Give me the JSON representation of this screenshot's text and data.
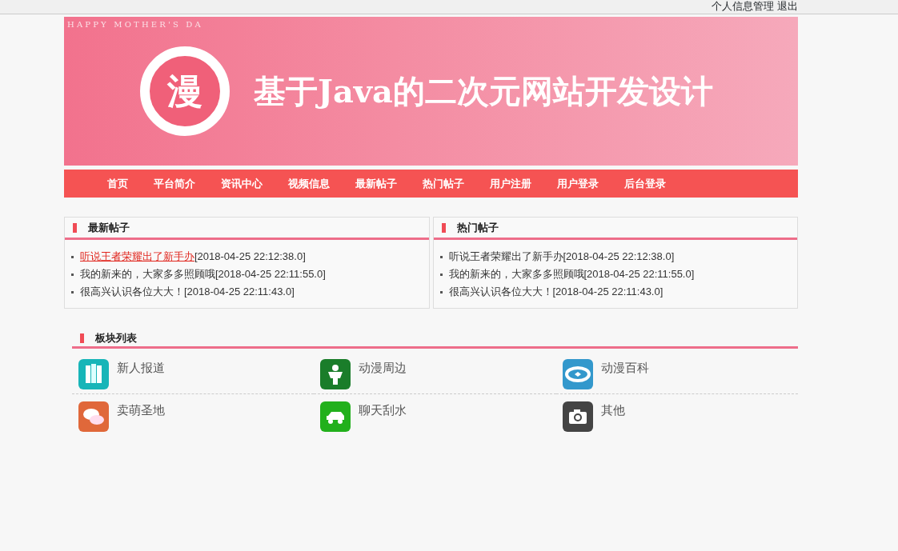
{
  "top_links": [
    "个人信息管理",
    "退出"
  ],
  "banner": {
    "tagline": "H A P P Y   M O T H E R ' S   D A",
    "logo_char": "漫",
    "title": "基于Java的二次元网站开发设计"
  },
  "nav": [
    "首页",
    "平台简介",
    "资讯中心",
    "视频信息",
    "最新帖子",
    "热门帖子",
    "用户注册",
    "用户登录",
    "后台登录"
  ],
  "panels": [
    {
      "title": "最新帖子",
      "posts": [
        {
          "title": "听说王者荣耀出了新手办",
          "time": "[2018-04-25 22:12:38.0]",
          "hovered": true
        },
        {
          "title": "我的新来的，大家多多照顾哦",
          "time": "[2018-04-25 22:11:55.0]",
          "hovered": false
        },
        {
          "title": "很高兴认识各位大大！",
          "time": "[2018-04-25 22:11:43.0]",
          "hovered": false
        }
      ]
    },
    {
      "title": "热门帖子",
      "posts": [
        {
          "title": "听说王者荣耀出了新手办",
          "time": "[2018-04-25 22:12:38.0]",
          "hovered": false
        },
        {
          "title": "我的新来的，大家多多照顾哦",
          "time": "[2018-04-25 22:11:55.0]",
          "hovered": false
        },
        {
          "title": "很高兴认识各位大大！",
          "time": "[2018-04-25 22:11:43.0]",
          "hovered": false
        }
      ]
    }
  ],
  "boards": {
    "title": "板块列表",
    "items": [
      {
        "name": "新人报道",
        "kind": "book",
        "color": "#17b5b8"
      },
      {
        "name": "动漫周边",
        "kind": "figure",
        "color": "#1a7d2a"
      },
      {
        "name": "动漫百科",
        "kind": "film",
        "color": "#3398cc"
      },
      {
        "name": "卖萌圣地",
        "kind": "chat",
        "color": "#e0683a"
      },
      {
        "name": "聊天刮水",
        "kind": "car",
        "color": "#22b01c"
      },
      {
        "name": "其他",
        "kind": "camera",
        "color": "#444444"
      }
    ]
  }
}
